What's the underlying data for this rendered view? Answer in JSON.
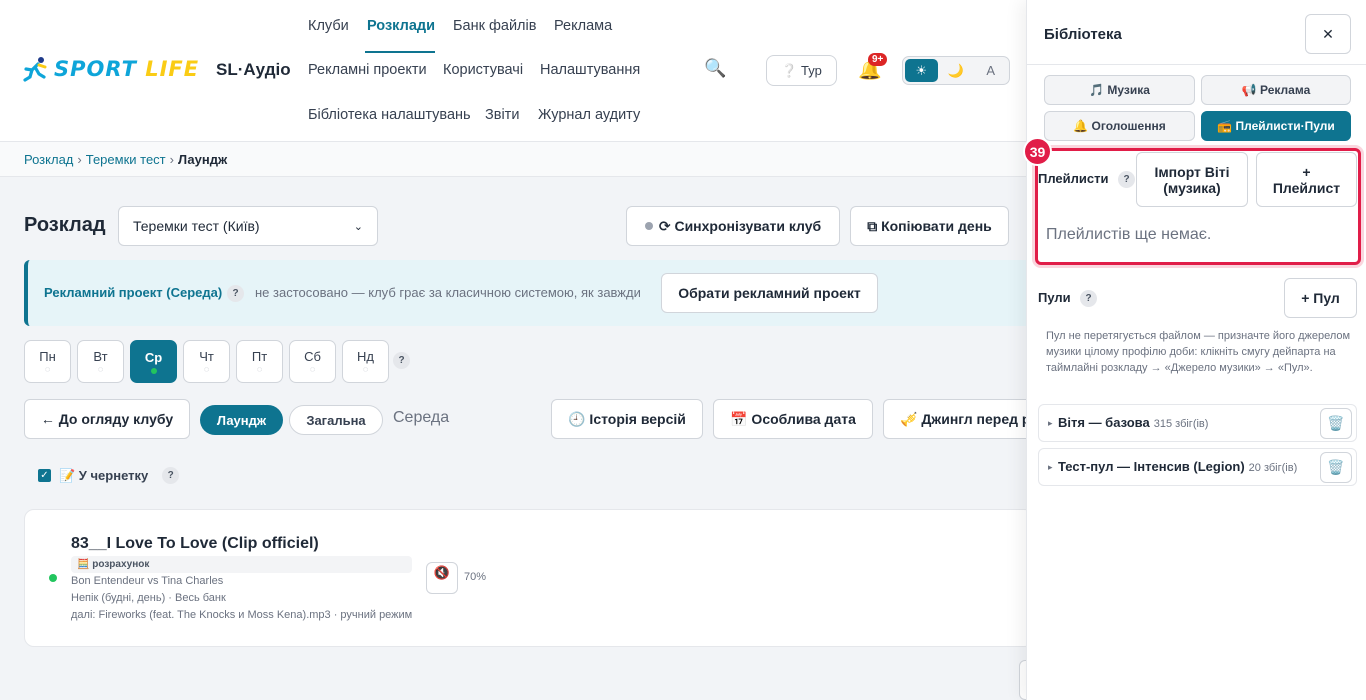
{
  "header": {
    "logo": {
      "part1": "SPORT",
      "part2": "LIFE"
    },
    "app_name": "SL·Аудіо",
    "nav": {
      "clubs": "Клуби",
      "schedule": "Розклади",
      "file_bank": "Банк файлів",
      "ads": "Реклама",
      "ad_projects": "Рекламні проекти",
      "users": "Користувачі",
      "settings": "Налаштування",
      "settings_library": "Бібліотека налаштувань",
      "reports": "Звіти",
      "audit_log": "Журнал аудиту"
    },
    "tour_label": "❔ Тур",
    "notifications_badge": "9+",
    "theme": {
      "light": "☀",
      "dark": "🌙",
      "auto": "A"
    }
  },
  "breadcrumb": {
    "item1": "Розклад",
    "item2": "Теремки тест",
    "current": "Лаундж",
    "sep": "›"
  },
  "main": {
    "title": "Розклад",
    "club_select": "Теремки тест (Київ)",
    "sync_button": "⟳ Синхронізувати клуб",
    "copy_day_button": "⧉ Копіювати день",
    "ad_project": {
      "title": "Рекламний проект (Середа)",
      "status": "не застосовано — клуб грає за класичною системою, як завжди",
      "choose_button": "Обрати рекламний проект"
    },
    "days": [
      {
        "label": "Пн",
        "sub": "◌"
      },
      {
        "label": "Вт",
        "sub": "◌"
      },
      {
        "label": "Ср",
        "sub": ""
      },
      {
        "label": "Чт",
        "sub": "◌"
      },
      {
        "label": "Пт",
        "sub": "◌"
      },
      {
        "label": "Сб",
        "sub": "◌"
      },
      {
        "label": "Нд",
        "sub": "◌"
      }
    ],
    "back_button": "← До огляду клубу",
    "zone_tabs": {
      "lounge": "Лаундж",
      "general": "Загальна"
    },
    "day_name": "Середа",
    "history_button": "🕘 Історія версій",
    "special_date_button": "📅 Особлива дата",
    "jingle_button": "🎺 Джингл перед р",
    "draft_label": "📝 У чернетку",
    "help": "?",
    "track": {
      "title": "83__I Love To Love (Clip officiel)",
      "badge": "🧮 розрахунок",
      "artist": "Bon Entendeur vs Tina Charles",
      "source": "Непік (будні, день) · Весь банк",
      "next": "далі: Fireworks (feat. The Knocks и Moss Kena).mp3 · ручний режим",
      "mute_icon": "🔇",
      "volume": "70%"
    }
  },
  "panel": {
    "title": "Бібліотека",
    "close": "✕",
    "tabs": {
      "music": "🎵 Музика",
      "ads": "📢 Реклама",
      "announcements": "🔔 Оголошення",
      "playlists_pools": "📻 Плейлисти·Пули"
    },
    "marker_number": "39",
    "playlists": {
      "label": "Плейлисти",
      "import_button": "Імпорт Віті (музика)",
      "add_button": "+ Плейлист",
      "empty": "Плейлистів ще немає."
    },
    "pools": {
      "label": "Пули",
      "add_button": "+ Пул",
      "note": "Пул не перетягується файлом — призначте його джерелом музики цілому профілю доби: клікніть смугу дейпарта на таймлайні розкладу → «Джерело музики» → «Пул».",
      "items": [
        {
          "name": "Вітя — базова",
          "count": "315 збіг(ів)"
        },
        {
          "name": "Тест-пул — Інтенсив (Legion)",
          "count": "20 збіг(ів)"
        }
      ],
      "trash_icon": "🗑️",
      "arrow": "▸"
    }
  },
  "colors": {
    "accent": "#0e7490",
    "highlight": "#e11d48",
    "logo_blue": "#0ea5d9",
    "logo_yellow": "#facc15"
  }
}
